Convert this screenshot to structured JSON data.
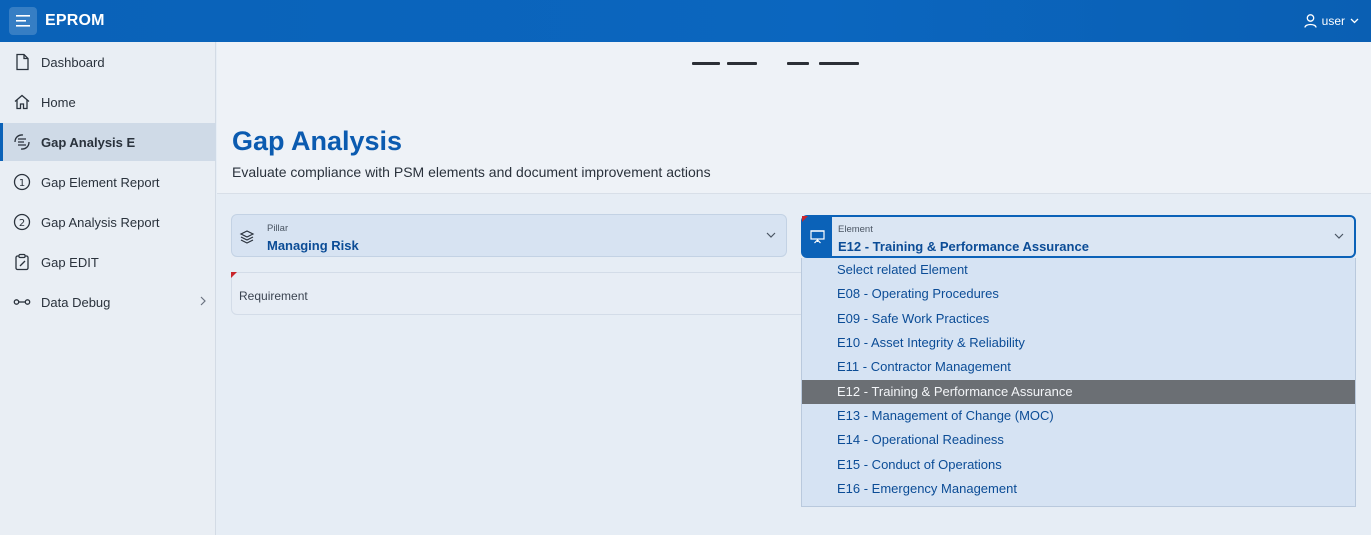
{
  "app": {
    "title": "EPROM"
  },
  "user": {
    "name": "user"
  },
  "sidebar": {
    "items": [
      {
        "label": "Dashboard",
        "icon": "file-icon"
      },
      {
        "label": "Home",
        "icon": "home-icon"
      },
      {
        "label": "Gap Analysis E",
        "icon": "gap-analysis-icon",
        "active": true
      },
      {
        "label": "Gap Element Report",
        "icon": "number-1-icon"
      },
      {
        "label": "Gap Analysis Report",
        "icon": "number-2-icon"
      },
      {
        "label": "Gap EDIT",
        "icon": "clipboard-edit-icon"
      },
      {
        "label": "Data Debug",
        "icon": "link-icon",
        "has_submenu": true
      }
    ]
  },
  "page": {
    "title": "Gap Analysis",
    "subtitle": "Evaluate compliance with PSM elements and document improvement actions"
  },
  "form": {
    "pillar": {
      "label": "Pillar",
      "value": "Managing Risk"
    },
    "element": {
      "label": "Element",
      "value": "E12 - Training & Performance Assurance"
    },
    "requirement": {
      "label": "Requirement"
    }
  },
  "element_dropdown": {
    "options": [
      "Select related Element",
      "E08 - Operating Procedures",
      "E09 - Safe Work Practices",
      "E10 - Asset Integrity & Reliability",
      "E11 - Contractor Management",
      "E12 - Training & Performance Assurance",
      "E13 - Management of Change (MOC)",
      "E14 - Operational Readiness",
      "E15 - Conduct of Operations",
      "E16 - Emergency Management"
    ],
    "selected": "E12 - Training & Performance Assurance"
  },
  "colors": {
    "brand": "#0b62b8",
    "title": "#0b5bb0",
    "required": "#c9252b",
    "selected_option": "#6b6f74"
  }
}
